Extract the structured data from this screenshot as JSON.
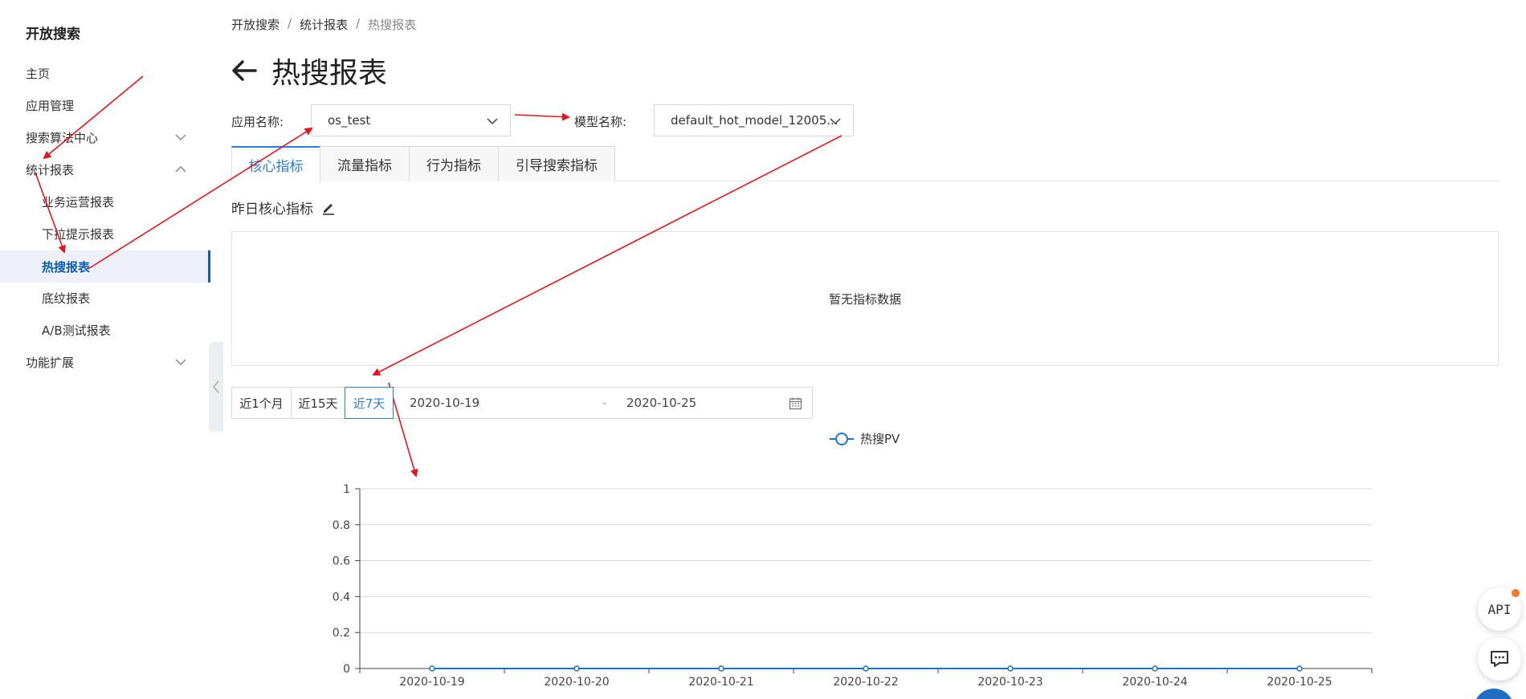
{
  "sidebar": {
    "title": "开放搜索",
    "items": [
      {
        "label": "主页"
      },
      {
        "label": "应用管理"
      },
      {
        "label": "搜索算法中心"
      },
      {
        "label": "统计报表"
      },
      {
        "label": "业务运营报表"
      },
      {
        "label": "下拉提示报表"
      },
      {
        "label": "热搜报表"
      },
      {
        "label": "底纹报表"
      },
      {
        "label": "A/B测试报表"
      },
      {
        "label": "功能扩展"
      }
    ]
  },
  "breadcrumb": [
    "开放搜索",
    "统计报表",
    "热搜报表"
  ],
  "page": {
    "title": "热搜报表"
  },
  "filters": {
    "app_label": "应用名称:",
    "app_value": "os_test",
    "model_label": "模型名称:",
    "model_value": "default_hot_model_12005..."
  },
  "tabs": [
    "核心指标",
    "流量指标",
    "行为指标",
    "引导搜索指标"
  ],
  "section": {
    "title": "昨日核心指标",
    "empty_text": "暂无指标数据"
  },
  "date_filter": {
    "ranges": [
      "近1个月",
      "近15天",
      "近7天"
    ],
    "active_range": "近7天",
    "start": "2020-10-19",
    "end": "2020-10-25",
    "separator": "-"
  },
  "chart_data": {
    "type": "line",
    "x": [
      "2020-10-19",
      "2020-10-20",
      "2020-10-21",
      "2020-10-22",
      "2020-10-23",
      "2020-10-24",
      "2020-10-25"
    ],
    "series": [
      {
        "name": "热搜PV",
        "values": [
          0,
          0,
          0,
          0,
          0,
          0,
          0
        ],
        "color": "#1e73c8"
      }
    ],
    "ylim": [
      0,
      1
    ],
    "yticks": [
      "0",
      "0.2",
      "0.4",
      "0.6",
      "0.8",
      "1"
    ],
    "grid": true,
    "legend": "top-center"
  },
  "floating": {
    "api_label": "API"
  },
  "colors": {
    "accent": "#2b7fd8",
    "annotation": "#e8141b"
  }
}
